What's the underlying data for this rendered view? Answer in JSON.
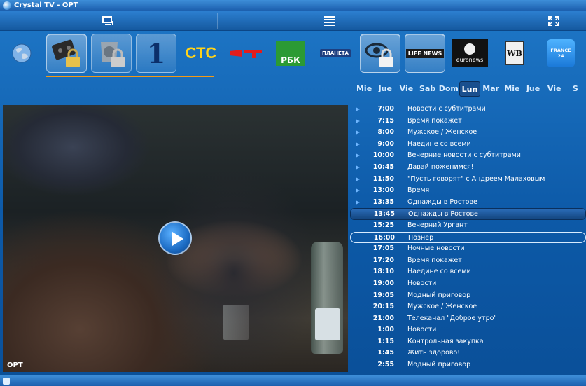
{
  "window": {
    "title": "Crystal TV - OPT"
  },
  "toolbar": {
    "icons": [
      "monitor-icon",
      "list-icon",
      "fullscreen-icon"
    ]
  },
  "channels": [
    {
      "name": "globe",
      "icon": "globe-icon"
    },
    {
      "name": "locked-tape",
      "icon": "lock-icon"
    },
    {
      "name": "locked-tv",
      "icon": "lock-icon"
    },
    {
      "name": "Первый",
      "logo_text": "1"
    },
    {
      "name": "СТС",
      "logo_text": "СТС"
    },
    {
      "name": "Пятый",
      "logo_text": "5"
    },
    {
      "name": "РБК",
      "logo_text": "РБК"
    },
    {
      "name": "Планета",
      "logo_text": "ПЛАНЕТА"
    },
    {
      "name": "locked-eye",
      "icon": "lock-icon"
    },
    {
      "name": "LifeNews",
      "logo_text": "LIFE NEWS"
    },
    {
      "name": "euronews",
      "logo_text": "euronews"
    },
    {
      "name": "WB",
      "logo_text": "WB"
    },
    {
      "name": "France 24",
      "logo_text": "FRANCE 24"
    }
  ],
  "days": [
    "Mie",
    "Jue",
    "Vie",
    "Sab",
    "Dom",
    "Lun",
    "Mar",
    "Mie",
    "Jue",
    "Vie",
    "S"
  ],
  "active_day_index": 5,
  "video": {
    "channel_label": "OPT"
  },
  "schedule": [
    {
      "time": "7:00",
      "title": "Новости с субтитрами",
      "arrow": true
    },
    {
      "time": "7:15",
      "title": "Время покажет",
      "arrow": true
    },
    {
      "time": "8:00",
      "title": "Мужское / Женское",
      "arrow": true
    },
    {
      "time": "9:00",
      "title": "Наедине со всеми",
      "arrow": true
    },
    {
      "time": "10:00",
      "title": "Вечерние новости с субтитрами",
      "arrow": true
    },
    {
      "time": "10:45",
      "title": "Давай поженимся!",
      "arrow": true
    },
    {
      "time": "11:50",
      "title": "\"Пусть говорят\" с Андреем Малаховым",
      "arrow": true
    },
    {
      "time": "13:00",
      "title": "Время",
      "arrow": true
    },
    {
      "time": "13:35",
      "title": "Однажды в Ростове",
      "arrow": true
    },
    {
      "time": "13:45",
      "title": "Однажды в Ростове",
      "arrow": false,
      "current": true
    },
    {
      "time": "15:25",
      "title": "Вечерний Ургант",
      "arrow": false
    },
    {
      "time": "16:00",
      "title": "Познер",
      "arrow": false,
      "hover": true
    },
    {
      "time": "17:05",
      "title": "Ночные новости",
      "arrow": false
    },
    {
      "time": "17:20",
      "title": "Время покажет",
      "arrow": false
    },
    {
      "time": "18:10",
      "title": "Наедине со всеми",
      "arrow": false
    },
    {
      "time": "19:00",
      "title": "Новости",
      "arrow": false
    },
    {
      "time": "19:05",
      "title": "Модный приговор",
      "arrow": false
    },
    {
      "time": "20:15",
      "title": "Мужское / Женское",
      "arrow": false
    },
    {
      "time": "21:00",
      "title": "Телеканал \"Доброе утро\"",
      "arrow": false
    },
    {
      "time": "1:00",
      "title": "Новости",
      "arrow": false
    },
    {
      "time": "1:15",
      "title": "Контрольная закупка",
      "arrow": false
    },
    {
      "time": "1:45",
      "title": "Жить здорово!",
      "arrow": false
    },
    {
      "time": "2:55",
      "title": "Модный приговор",
      "arrow": false
    }
  ],
  "colors": {
    "background": "#1268b8",
    "accent": "#f39a16",
    "arrow": "#6fb6ff"
  }
}
